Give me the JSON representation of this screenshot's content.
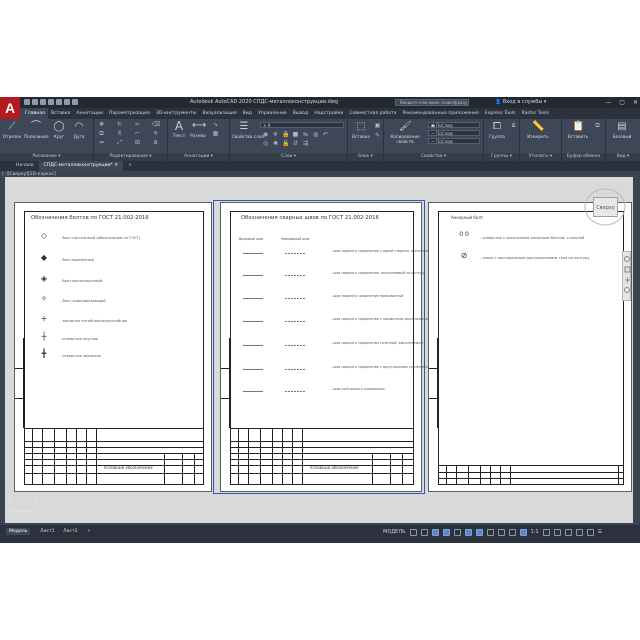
{
  "titlebar": {
    "app_title": "Autodesk AutoCAD 2020",
    "file_title": "СПДС-металлоконструкции.dwg",
    "search_placeholder": "Введите ключевое слово/фразу",
    "signin": "Вход в службы"
  },
  "menu_tabs": [
    "Главная",
    "Вставка",
    "Аннотации",
    "Параметризация",
    "3D-инструменты",
    "Визуализация",
    "Вид",
    "Управление",
    "Вывод",
    "Надстройки",
    "Совместная работа",
    "Рекомендованные приложения",
    "Express Tools",
    "Raster Tools"
  ],
  "ribbon": {
    "draw": {
      "label": "Рисование",
      "tools": [
        "Отрезок",
        "Полилиния",
        "Круг",
        "Дуга"
      ]
    },
    "modify": {
      "label": "Редактирование"
    },
    "annotation": {
      "label": "Аннотации",
      "tools": [
        "Текст",
        "Размер"
      ]
    },
    "layers": {
      "label": "Слои",
      "tools": [
        "Свойства слоя"
      ],
      "layer_value": "0"
    },
    "block": {
      "label": "Блок",
      "tools": [
        "Вставка"
      ]
    },
    "properties": {
      "label": "Свойства",
      "tools": [
        "Копирование свойств"
      ],
      "color_value": "ПоСлою",
      "linetype_value": "ПоСлою",
      "lineweight_value": "ПоСлою"
    },
    "groups": {
      "label": "Группы",
      "tools": [
        "Группа"
      ]
    },
    "utilities": {
      "label": "Утилиты",
      "tools": [
        "Измерить"
      ]
    },
    "clipboard": {
      "label": "Буфер обмена",
      "tools": [
        "Вставить"
      ]
    },
    "view": {
      "label": "Вид",
      "tools": [
        "Базовый"
      ]
    }
  },
  "file_tabs": [
    "Начало",
    "СПДС-металлоконструкции*"
  ],
  "viewport_label": "[–][Сверху][2D-каркас]",
  "sheet1": {
    "title": "Обозначения болтов по ГОСТ 21.002-2016",
    "rows": [
      {
        "icon": "◇",
        "text": "- болт постоянный (обозначение по ГОСТ)"
      },
      {
        "icon": "◆",
        "text": "- болт временный"
      },
      {
        "icon": "◈",
        "text": "- болт высокопрочный"
      },
      {
        "icon": "✧",
        "text": "- болт самонарезающий"
      },
      {
        "icon": "+",
        "text": "- заклепка потайная/полупотайная"
      },
      {
        "icon": "┼",
        "text": "- отверстие круглое"
      },
      {
        "icon": "╋",
        "text": "- отверстие овальное"
      }
    ],
    "titleblock_caption": "Условные обозначения"
  },
  "sheet2": {
    "title": "Обозначения сварных швов по ГОСТ 21.002-2016",
    "col_headers": [
      "Видимый шов",
      "Невидимый шов"
    ],
    "rows": [
      "- шов сварного соединения с одной стороны, выполняемый",
      "- шов сварного соединения, выполняемый по контуру",
      "- шов сварного соединения прерывистый",
      "- шов сварного соединения с шахматным расположением",
      "- шов сварного соединения точечный, выполняемый",
      "- шов сварного соединения с двусторонним усилением",
      "- шов монтажного соединения"
    ],
    "titleblock_caption": "Условные обозначения"
  },
  "sheet3": {
    "title": "Анкерный болт",
    "rows": [
      {
        "icon": "0 0",
        "text": "- отверстие с креплением анкерным болтом, стальной"
      },
      {
        "icon": "⊘",
        "text": "- анкер с вертикальным расположением тела по контуру"
      }
    ]
  },
  "viewcube": {
    "face": "Сверху"
  },
  "layout_tabs": [
    "Модель",
    "Лист1",
    "Лист2",
    "+"
  ],
  "status": {
    "mode": "МОДЕЛЬ",
    "scale": "1:1"
  }
}
